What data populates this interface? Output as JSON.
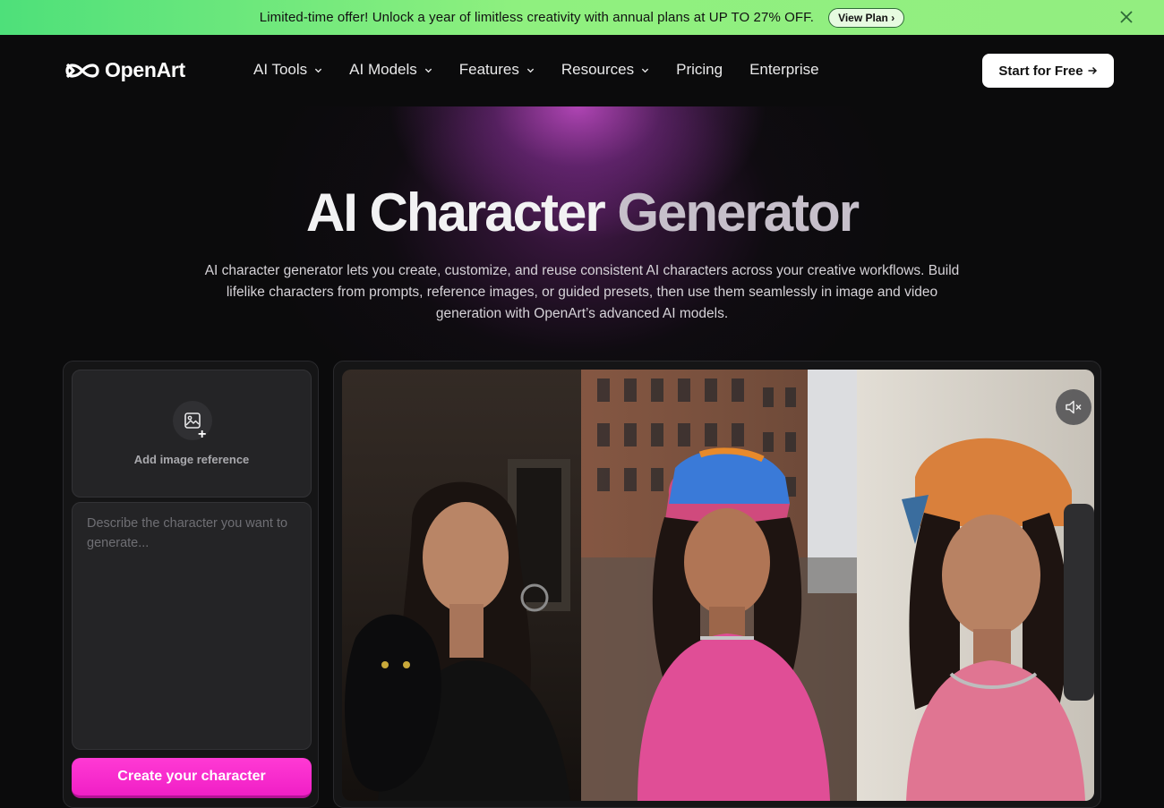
{
  "promo": {
    "text": "Limited-time offer! Unlock a year of limitless creativity with annual plans at UP TO 27% OFF.",
    "button": "View Plan ›",
    "close_icon": "close-icon",
    "colors": {
      "banner_start": "#4ee07a",
      "banner_end": "#93ee80"
    }
  },
  "header": {
    "brand": "OpenArt",
    "logo_icon": "infinity-logo-icon",
    "nav": [
      {
        "label": "AI Tools",
        "has_dropdown": true
      },
      {
        "label": "AI Models",
        "has_dropdown": true
      },
      {
        "label": "Features",
        "has_dropdown": true
      },
      {
        "label": "Resources",
        "has_dropdown": true
      },
      {
        "label": "Pricing",
        "has_dropdown": false
      },
      {
        "label": "Enterprise",
        "has_dropdown": false
      }
    ],
    "cta": "Start for Free",
    "cta_icon": "arrow-right-icon"
  },
  "hero": {
    "title_part1": "AI Character",
    "title_part2": "Generator",
    "subtitle": "AI character generator lets you create, customize, and reuse consistent AI characters across your creative workflows. Build lifelike characters from prompts, reference images, or guided presets, then use them seamlessly in image and video generation with OpenArt’s advanced AI models.",
    "glow_color": "#c94ece"
  },
  "generator": {
    "upload_label": "Add image reference",
    "upload_icon": "image-icon",
    "prompt_placeholder": "Describe the character you want to generate...",
    "prompt_value": "",
    "create_button": "Create your character",
    "accent": "#f01fc6"
  },
  "preview": {
    "mute_icon": "volume-muted-icon"
  }
}
